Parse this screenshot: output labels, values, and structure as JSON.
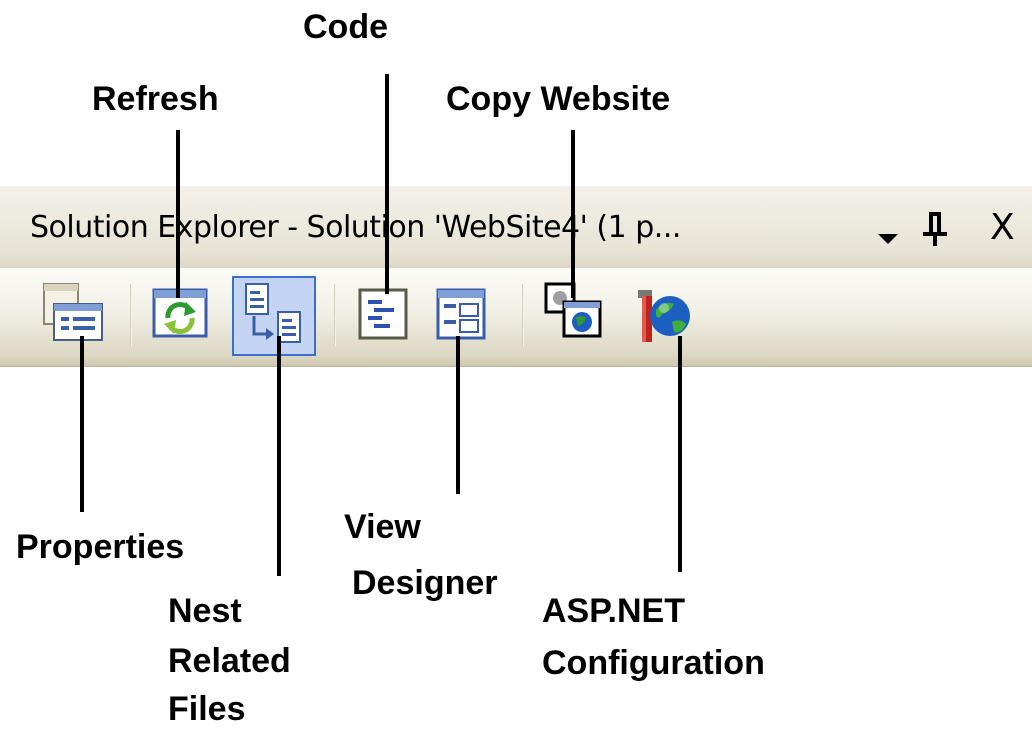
{
  "callouts": {
    "code": "Code",
    "refresh": "Refresh",
    "copy_website": "Copy Website",
    "properties": "Properties",
    "view_designer_line1": "View",
    "view_designer_line2": "Designer",
    "nest_line1": "Nest",
    "nest_line2": "Related",
    "nest_line3": "Files",
    "aspnet_line1": "ASP.NET",
    "aspnet_line2": "Configuration"
  },
  "window": {
    "title": "Solution Explorer - Solution 'WebSite4' (1 p...",
    "menu_icon": "chevron-down-icon",
    "pin_icon": "pin-icon",
    "close_label": "X"
  },
  "toolbar": {
    "buttons": [
      "properties-icon",
      "refresh-icon",
      "nest-related-files-icon",
      "view-code-icon",
      "view-designer-icon",
      "copy-website-icon",
      "aspnet-configuration-icon"
    ],
    "active_button": "nest-related-files-icon"
  },
  "colors": {
    "titlebar": "#e7e3d5",
    "toolbar": "#f2f0e6",
    "active_button_fill": "#c3d5f3",
    "active_button_border": "#3a6fd0"
  }
}
